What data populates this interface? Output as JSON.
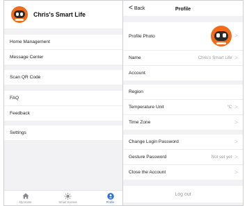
{
  "left": {
    "header": {
      "title": "Chris's Smart Life"
    },
    "menu": [
      {
        "label": "Home Management"
      },
      {
        "label": "Message Center"
      },
      {
        "label": "Scan QR Code"
      },
      {
        "label": "FAQ"
      },
      {
        "label": "Feedback"
      },
      {
        "label": "Settings"
      }
    ],
    "tabs": [
      {
        "label": "My Home",
        "icon": "house-icon"
      },
      {
        "label": "Smart Scenes",
        "icon": "sun-icon"
      },
      {
        "label": "Profile",
        "icon": "person-icon",
        "active": true
      }
    ],
    "colors": {
      "accent": "#2a6cd6",
      "avatar": "#f26b1d"
    }
  },
  "right": {
    "nav": {
      "back_label": "Back",
      "title": "Profile"
    },
    "rows": [
      {
        "label": "Profile Photo"
      },
      {
        "label": "Name",
        "value": "Chris's Smart Life"
      },
      {
        "label": "Account"
      },
      {
        "label": "Region"
      },
      {
        "label": "Temperature Unit",
        "value": "°C"
      },
      {
        "label": "Time Zone"
      },
      {
        "label": "Change Login Password"
      },
      {
        "label": "Gesture Password",
        "value": "Not set yet"
      },
      {
        "label": "Close the Account"
      }
    ],
    "logout_label": "Log out"
  }
}
